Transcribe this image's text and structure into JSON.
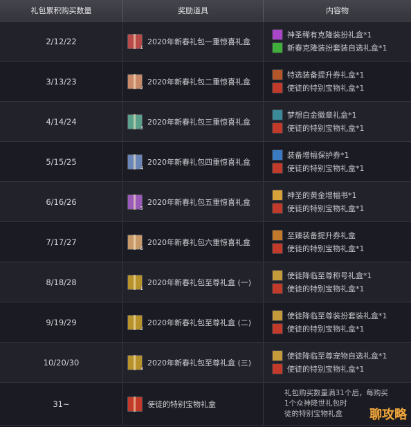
{
  "header": {
    "col1": "礼包累积购买数量",
    "col2": "奖励道具",
    "col3": "内容物"
  },
  "rows": [
    {
      "count": "2/12/22",
      "reward": "2020年新春礼包一重惊喜礼盒",
      "badge": "1",
      "gift_color": "#b84a4a",
      "items": [
        {
          "label": "神圣稀有克隆装扮礼盒*1",
          "color": "#a845c9"
        },
        {
          "label": "新春克隆装扮套装自选礼盒*1",
          "color": "#3fae3a"
        }
      ]
    },
    {
      "count": "3/13/23",
      "reward": "2020年新春礼包二重惊喜礼盒",
      "badge": "2",
      "gift_color": "#c98a6a",
      "items": [
        {
          "label": "特选装备提升券礼盒*1",
          "color": "#b5562a"
        },
        {
          "label": "使徒的特别宝物礼盒*1",
          "color": "#c23a2a"
        }
      ]
    },
    {
      "count": "4/14/24",
      "reward": "2020年新春礼包三重惊喜礼盒",
      "badge": "3",
      "gift_color": "#5aa08a",
      "items": [
        {
          "label": "梦想白金徽章礼盒*1",
          "color": "#3a8a9a"
        },
        {
          "label": "使徒的特别宝物礼盒*1",
          "color": "#c23a2a"
        }
      ]
    },
    {
      "count": "5/15/25",
      "reward": "2020年新春礼包四重惊喜礼盒",
      "badge": "4",
      "gift_color": "#6a86b8",
      "items": [
        {
          "label": "装备增幅保护券*1",
          "color": "#3a7ac2"
        },
        {
          "label": "使徒的特别宝物礼盒*1",
          "color": "#c23a2a"
        }
      ]
    },
    {
      "count": "6/16/26",
      "reward": "2020年新春礼包五重惊喜礼盒",
      "badge": "5",
      "gift_color": "#9a5ab8",
      "items": [
        {
          "label": "神圣的黄金增幅书*1",
          "color": "#d8a23a"
        },
        {
          "label": "使徒的特别宝物礼盒*1",
          "color": "#c23a2a"
        }
      ]
    },
    {
      "count": "7/17/27",
      "reward": "2020年新春礼包六重惊喜礼盒",
      "badge": "6",
      "gift_color": "#c89a6a",
      "items": [
        {
          "label": "至臻装备提升券礼盒",
          "color": "#c27a2a"
        },
        {
          "label": "使徒的特别宝物礼盒*1",
          "color": "#c23a2a"
        }
      ]
    },
    {
      "count": "8/18/28",
      "reward": "2020年新春礼包至尊礼盒 (一)",
      "badge": "1",
      "gift_color": "#b8922a",
      "items": [
        {
          "label": "使徒降临至尊称号礼盒*1",
          "color": "#c49a3a"
        },
        {
          "label": "使徒的特别宝物礼盒*1",
          "color": "#c23a2a"
        }
      ]
    },
    {
      "count": "9/19/29",
      "reward": "2020年新春礼包至尊礼盒 (二)",
      "badge": "2",
      "gift_color": "#b8922a",
      "items": [
        {
          "label": "使徒降临至尊装扮套装礼盒*1",
          "color": "#c49a3a"
        },
        {
          "label": "使徒的特别宝物礼盒*1",
          "color": "#c23a2a"
        }
      ]
    },
    {
      "count": "10/20/30",
      "reward": "2020年新春礼包至尊礼盒 (三)",
      "badge": "3",
      "gift_color": "#b8922a",
      "items": [
        {
          "label": "使徒降临至尊宠物自选礼盒*1",
          "color": "#c49a3a"
        },
        {
          "label": "使徒的特别宝物礼盒*1",
          "color": "#c23a2a"
        }
      ]
    }
  ],
  "last_row": {
    "count": "31~",
    "reward": "使徒的特别宝物礼盒",
    "gift_color": "#c23a2a",
    "note_line1": "礼包购买数量满31个后，每购买",
    "note_line2": "1个众神降世礼包时",
    "note_line3": "徒的特别宝物礼盒"
  },
  "watermark": "聊攻略"
}
